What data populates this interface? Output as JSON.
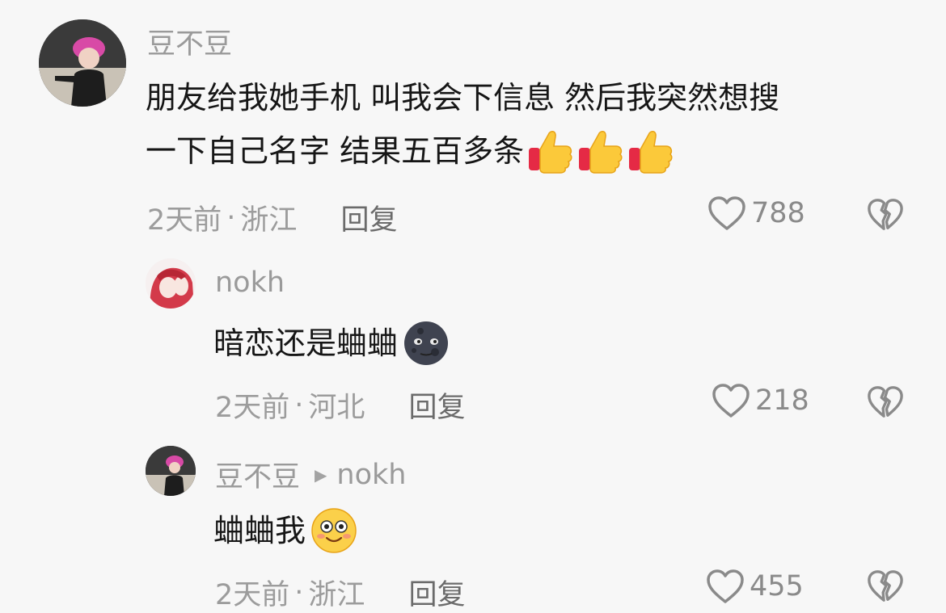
{
  "comments": [
    {
      "username": "豆不豆",
      "line1": "朋友给我她手机 叫我会下信息 然后我突然想搜",
      "line2": "一下自己名字 结果五百多条",
      "emojis": [
        "thumbs-up",
        "thumbs-up",
        "thumbs-up"
      ],
      "time": "2天前",
      "separator": "·",
      "location": "浙江",
      "reply_label": "回复",
      "likes": "788"
    },
    {
      "username": "nokh",
      "text": "暗恋还是蛐蛐",
      "emojis": [
        "new-moon-face"
      ],
      "time": "2天前",
      "separator": "·",
      "location": "河北",
      "reply_label": "回复",
      "likes": "218"
    },
    {
      "username": "豆不豆",
      "reply_to": "nokh",
      "text": "蛐蛐我",
      "emojis": [
        "flushed-smile-face"
      ],
      "time": "2天前",
      "separator": "·",
      "location": "浙江",
      "reply_label": "回复",
      "likes": "455"
    }
  ],
  "colors": {
    "background": "#f7f7f7",
    "text": "#161616",
    "muted": "#9c9c9c",
    "reply": "#6b6b6b"
  }
}
